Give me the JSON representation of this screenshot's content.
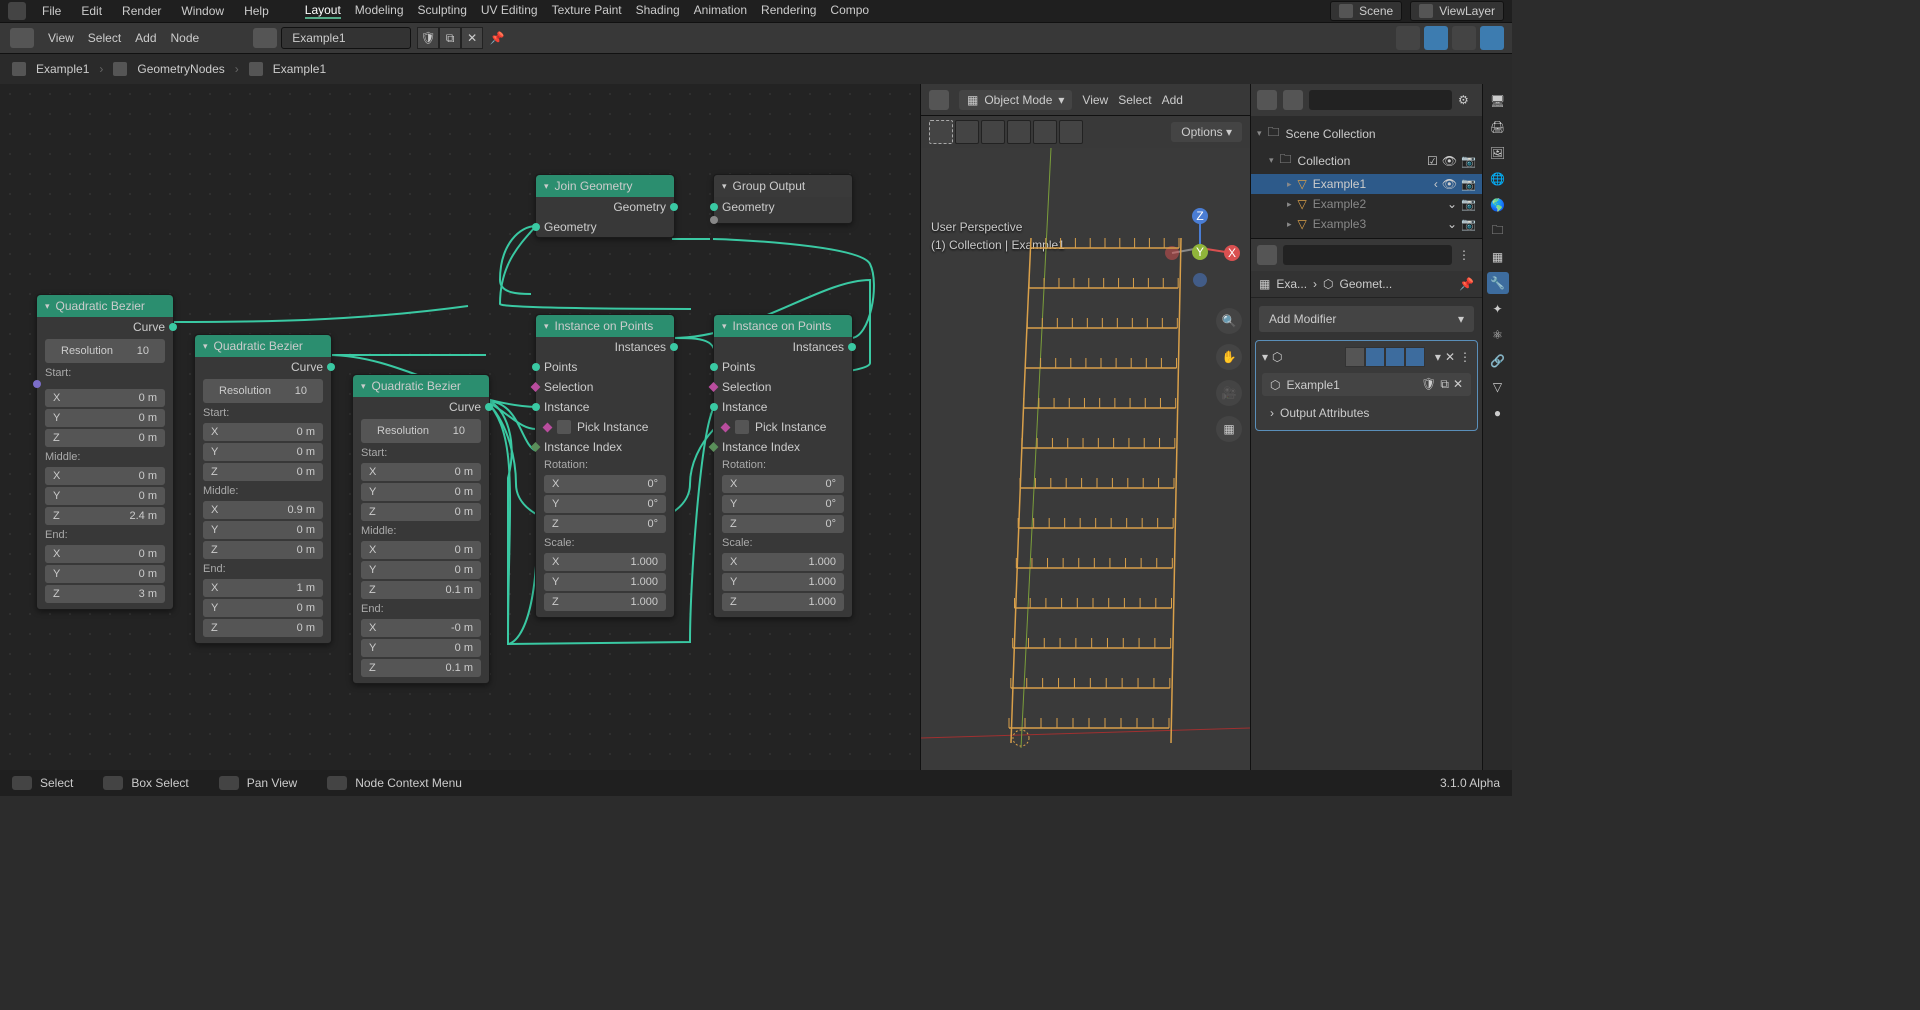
{
  "topmenu": [
    "File",
    "Edit",
    "Render",
    "Window",
    "Help"
  ],
  "tabs": [
    "Layout",
    "Modeling",
    "Sculpting",
    "UV Editing",
    "Texture Paint",
    "Shading",
    "Animation",
    "Rendering",
    "Compo"
  ],
  "scene_label": "Scene",
  "viewlayer_label": "ViewLayer",
  "nodeedit": {
    "menu": [
      "View",
      "Select",
      "Add",
      "Node"
    ],
    "groupname": "Example1",
    "crumbs": [
      "Example1",
      "GeometryNodes",
      "Example1"
    ]
  },
  "viewport": {
    "mode": "Object Mode",
    "menu": [
      "View",
      "Select",
      "Add"
    ],
    "options": "Options",
    "perspective": "User Perspective",
    "info": "(1) Collection | Example1"
  },
  "outliner": {
    "root": "Scene Collection",
    "coll": "Collection",
    "items": [
      "Example1",
      "Example2",
      "Example3"
    ]
  },
  "props": {
    "crumb1": "Exa...",
    "crumb2": "Geomet...",
    "addmod": "Add Modifier",
    "modname": "Example1",
    "outattr": "Output Attributes"
  },
  "nodes": {
    "qb_title": "Quadratic Bezier",
    "curve": "Curve",
    "resolution": "Resolution",
    "res_val": "10",
    "start": "Start:",
    "middle": "Middle:",
    "end": "End:",
    "join": "Join Geometry",
    "geometry": "Geometry",
    "groupout": "Group Output",
    "iop": "Instance on Points",
    "instances": "Instances",
    "points": "Points",
    "selection": "Selection",
    "instance": "Instance",
    "pickinst": "Pick Instance",
    "instidx": "Instance Index",
    "rotation": "Rotation:",
    "scale": "Scale:",
    "qb1": {
      "start": [
        "0 m",
        "0 m",
        "0 m"
      ],
      "middle": [
        "0 m",
        "0 m",
        "2.4 m"
      ],
      "end": [
        "0 m",
        "0 m",
        "3 m"
      ]
    },
    "qb2": {
      "start": [
        "0 m",
        "0 m",
        "0 m"
      ],
      "middle": [
        "0.9 m",
        "0 m",
        "0 m"
      ],
      "end": [
        "1 m",
        "0 m",
        "0 m"
      ]
    },
    "qb3": {
      "start": [
        "0 m",
        "0 m",
        "0 m"
      ],
      "middle": [
        "0 m",
        "0 m",
        "0.1 m"
      ],
      "end": [
        "-0 m",
        "0 m",
        "0.1 m"
      ]
    },
    "deg0": "0°",
    "scale1": "1.000",
    "axes": [
      "X",
      "Y",
      "Z"
    ]
  },
  "status": {
    "select": "Select",
    "boxsel": "Box Select",
    "pan": "Pan View",
    "ctx": "Node Context Menu",
    "ver": "3.1.0 Alpha"
  }
}
